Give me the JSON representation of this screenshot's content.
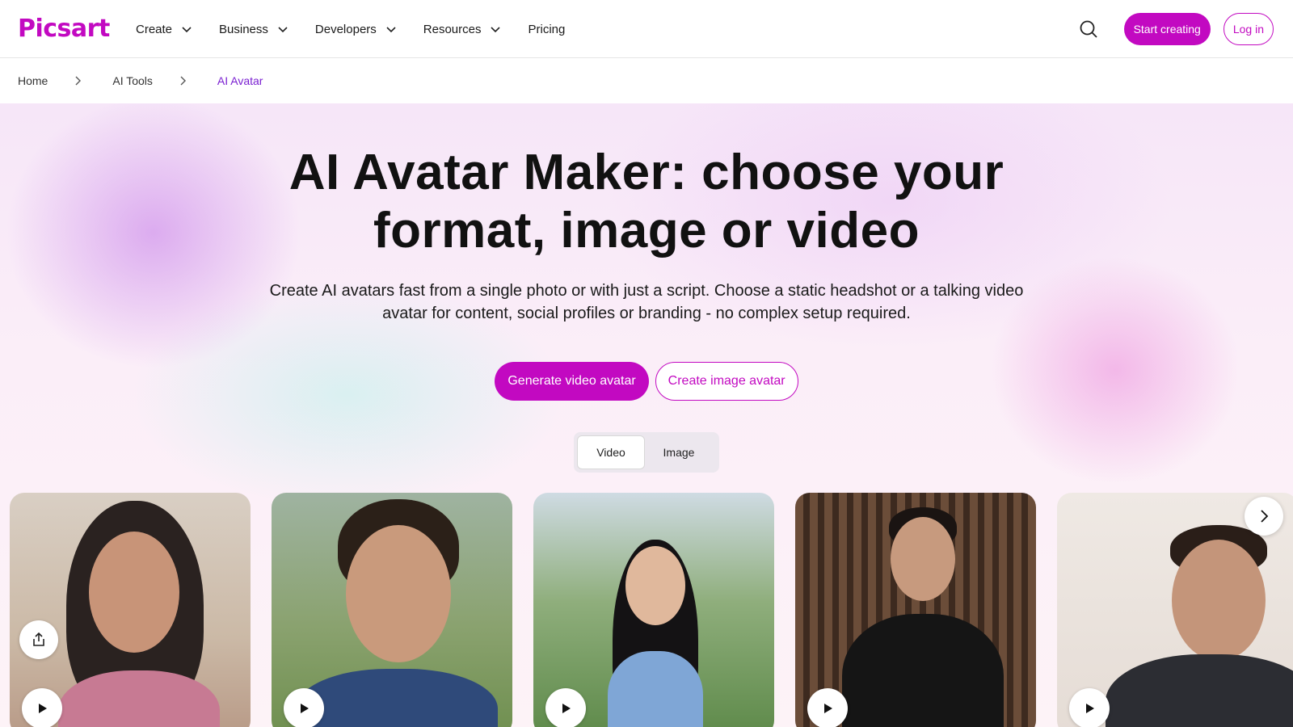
{
  "brand": {
    "logo_text": "Picsart",
    "accent": "#c209c1",
    "link_purple": "#7a1fd1"
  },
  "nav": {
    "items": [
      {
        "label": "Create",
        "has_dropdown": true
      },
      {
        "label": "Business",
        "has_dropdown": true
      },
      {
        "label": "Developers",
        "has_dropdown": true
      },
      {
        "label": "Resources",
        "has_dropdown": true
      },
      {
        "label": "Pricing",
        "has_dropdown": false
      }
    ],
    "search_icon": "search-icon",
    "start_label": "Start creating",
    "login_label": "Log in"
  },
  "breadcrumb": {
    "items": [
      {
        "label": "Home"
      },
      {
        "label": "AI Tools"
      },
      {
        "label": "AI Avatar"
      }
    ]
  },
  "hero": {
    "title_line1": "AI Avatar Maker: choose your",
    "title_line2": "format, image or video",
    "subtitle_line1": "Create AI avatars fast from a single photo or with just a script. Choose a static headshot or a talking video",
    "subtitle_line2": "avatar for content, social profiles or branding - no complex setup required.",
    "primary_cta": "Generate video avatar",
    "secondary_cta": "Create image avatar"
  },
  "format_toggle": {
    "options": [
      "Video",
      "Image"
    ],
    "selected": "Video"
  },
  "cards": {
    "icons": {
      "play": "play-icon",
      "share": "share-icon",
      "next": "chevron-right-icon"
    },
    "items": [
      {
        "subject": "woman-dark-wavy-hair"
      },
      {
        "subject": "man-curly-hair-outdoor"
      },
      {
        "subject": "woman-long-straight-hair-garden"
      },
      {
        "subject": "man-black-tshirt-slatted-wall"
      },
      {
        "subject": "man-beard-dark-shirt"
      }
    ]
  }
}
